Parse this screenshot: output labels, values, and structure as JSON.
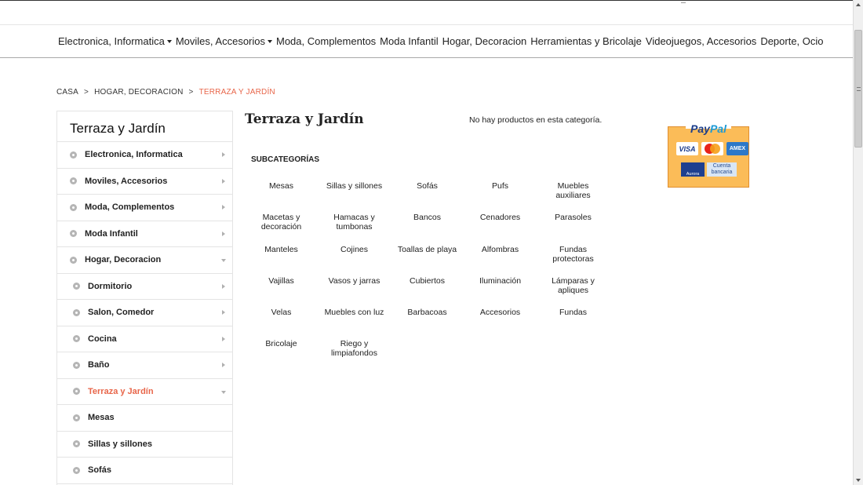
{
  "nav": {
    "items": [
      {
        "label": "Electronica, Informatica",
        "dropdown": true
      },
      {
        "label": "Moviles, Accesorios",
        "dropdown": true
      },
      {
        "label": "Moda, Complementos",
        "dropdown": false
      },
      {
        "label": "Moda Infantil",
        "dropdown": false
      },
      {
        "label": "Hogar, Decoracion",
        "dropdown": false
      },
      {
        "label": "Herramientas y Bricolaje",
        "dropdown": false
      },
      {
        "label": "Videojuegos, Accesorios",
        "dropdown": false
      },
      {
        "label": "Deporte, Ocio",
        "dropdown": false
      }
    ]
  },
  "breadcrumb": {
    "home": "CASA",
    "parent": "HOGAR, DECORACION",
    "current": "TERRAZA Y JARDÍN",
    "separator": ">"
  },
  "sidebar": {
    "title": "Terraza y Jardín",
    "items": [
      {
        "label": "Electronica, Informatica",
        "level": 0,
        "state": "collapsed"
      },
      {
        "label": "Moviles, Accesorios",
        "level": 0,
        "state": "collapsed"
      },
      {
        "label": "Moda, Complementos",
        "level": 0,
        "state": "collapsed"
      },
      {
        "label": "Moda Infantil",
        "level": 0,
        "state": "collapsed"
      },
      {
        "label": "Hogar, Decoracion",
        "level": 0,
        "state": "expanded"
      },
      {
        "label": "Dormitorio",
        "level": 1,
        "state": "collapsed"
      },
      {
        "label": "Salon, Comedor",
        "level": 1,
        "state": "collapsed"
      },
      {
        "label": "Cocina",
        "level": 1,
        "state": "collapsed"
      },
      {
        "label": "Baño",
        "level": 1,
        "state": "collapsed"
      },
      {
        "label": "Terraza y Jardín",
        "level": 1,
        "state": "expanded",
        "active": true
      },
      {
        "label": "Mesas",
        "level": 1,
        "state": "none"
      },
      {
        "label": "Sillas y sillones",
        "level": 1,
        "state": "none"
      },
      {
        "label": "Sofás",
        "level": 1,
        "state": "none"
      }
    ]
  },
  "main": {
    "title": "Terraza y Jardín",
    "empty_message": "No hay productos en esta categoría.",
    "subcategories_heading": "SUBCATEGORÍAS",
    "subcategories": [
      "Mesas",
      "Sillas y sillones",
      "Sofás",
      "Pufs",
      "Muebles auxiliares",
      "Macetas y decoración",
      "Hamacas y tumbonas",
      "Bancos",
      "Cenadores",
      "Parasoles",
      "Manteles",
      "Cojines",
      "Toallas de playa",
      "Alfombras",
      "Fundas protectoras",
      "Vajillas",
      "Vasos y jarras",
      "Cubiertos",
      "Iluminación",
      "Lámparas y apliques",
      "Velas",
      "Muebles con luz",
      "Barbacoas",
      "Accesorios",
      "Fundas",
      "Bricolaje",
      "Riego y limpiafondos"
    ]
  },
  "paypal": {
    "brand_a": "Pay",
    "brand_b": "Pal",
    "cards": [
      "VISA",
      "MasterCard",
      "AMEX"
    ],
    "bank_a": "Aurora",
    "bank_b": "Cuenta bancaria"
  },
  "colors": {
    "accent": "#e8664a",
    "paypal_bg": "#fbbc58",
    "paypal_blue": "#1b3e8c"
  }
}
